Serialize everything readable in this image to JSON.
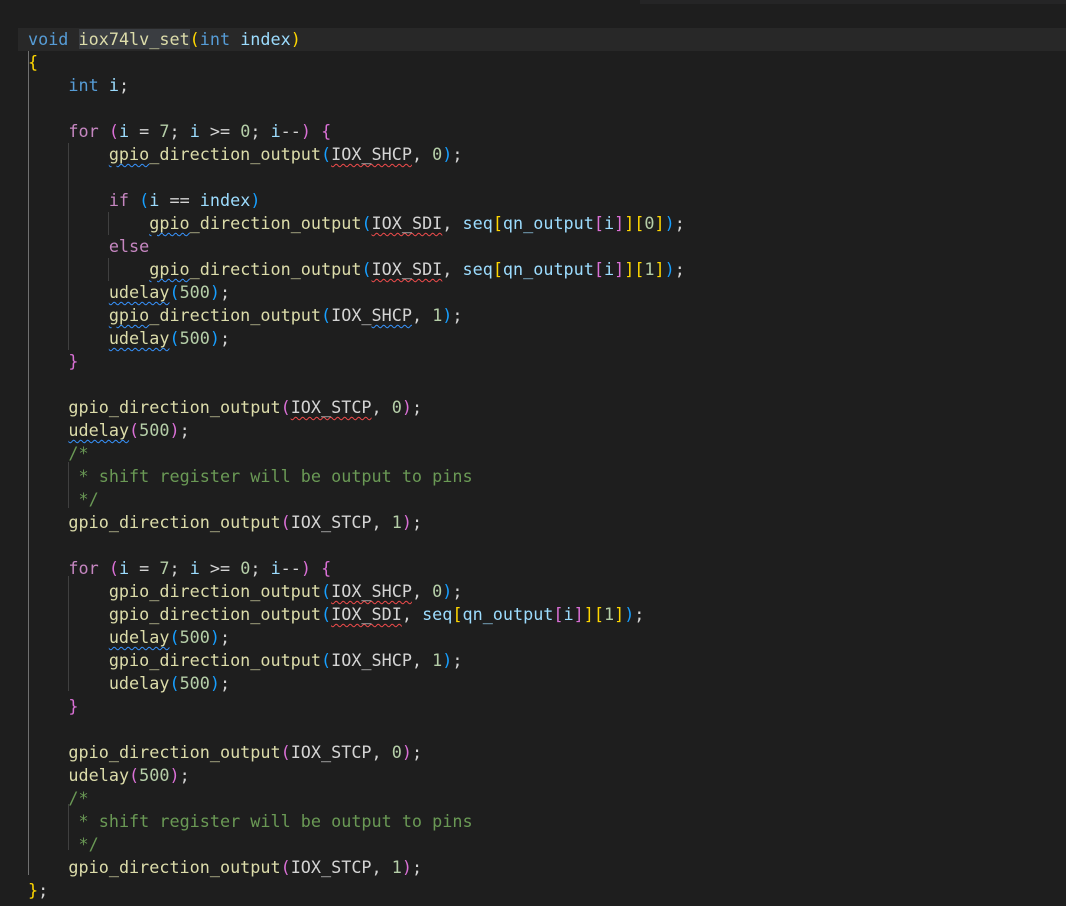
{
  "editor": {
    "language": "c",
    "highlighted_symbol": "iox74lv_set",
    "lines": [
      "void iox74lv_set(int index)",
      "{",
      "    int i;",
      "",
      "    for (i = 7; i >= 0; i--) {",
      "        gpio_direction_output(IOX_SHCP, 0);",
      "",
      "        if (i == index)",
      "            gpio_direction_output(IOX_SDI, seq[qn_output[i]][0]);",
      "        else",
      "            gpio_direction_output(IOX_SDI, seq[qn_output[i]][1]);",
      "        udelay(500);",
      "        gpio_direction_output(IOX_SHCP, 1);",
      "        udelay(500);",
      "    }",
      "",
      "    gpio_direction_output(IOX_STCP, 0);",
      "    udelay(500);",
      "    /*",
      "     * shift register will be output to pins",
      "     */",
      "    gpio_direction_output(IOX_STCP, 1);",
      "",
      "    for (i = 7; i >= 0; i--) {",
      "        gpio_direction_output(IOX_SHCP, 0);",
      "        gpio_direction_output(IOX_SDI, seq[qn_output[i]][1]);",
      "        udelay(500);",
      "        gpio_direction_output(IOX_SHCP, 1);",
      "        udelay(500);",
      "    }",
      "",
      "    gpio_direction_output(IOX_STCP, 0);",
      "    udelay(500);",
      "    /*",
      "     * shift register will be output to pins",
      "     */",
      "    gpio_direction_output(IOX_STCP, 1);",
      "};"
    ]
  }
}
